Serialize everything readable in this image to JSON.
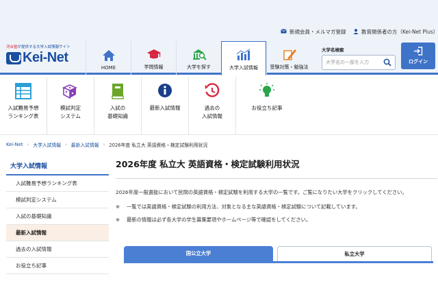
{
  "utility": {
    "signup": "新規会員・メルマガ登録",
    "educators": "教育関係者の方（Kei-Net Plus）"
  },
  "logo": {
    "tagline_prefix": "河合塾",
    "tagline_rest": "が提供する大学入試情報サイト",
    "name": "Kei-Net"
  },
  "nav": [
    {
      "label": "HOME",
      "icon": "home-icon",
      "color": "#3f73c8"
    },
    {
      "label": "学問情報",
      "icon": "graduation-cap-icon",
      "color": "#d9263f"
    },
    {
      "label": "大学を探す",
      "icon": "building-search-icon",
      "color": "#2aa64a"
    },
    {
      "label": "大学入試情報",
      "icon": "bar-chart-icon",
      "color": "#3f73c8"
    },
    {
      "label": "受験対策・勉強法",
      "icon": "pencil-note-icon",
      "color": "#e87d1e"
    }
  ],
  "search": {
    "title": "大学名検索",
    "placeholder": "大学名の一部を入力"
  },
  "login": {
    "label": "ログイン"
  },
  "categories": [
    {
      "line1": "入試難易予想",
      "line2": "ランキング表",
      "icon": "table-icon",
      "color": "#2a9fd6"
    },
    {
      "line1": "模試判定",
      "line2": "システム",
      "icon": "dice-icon",
      "color": "#8a3fb8"
    },
    {
      "line1": "入試の",
      "line2": "基礎知識",
      "icon": "book-icon",
      "color": "#6aa52a"
    },
    {
      "line1": "最新入試情報",
      "line2": "",
      "icon": "info-icon",
      "color": "#1a3f8a"
    },
    {
      "line1": "過去の",
      "line2": "入試情報",
      "icon": "history-icon",
      "color": "#d9263f"
    },
    {
      "line1": "お役立ち記事",
      "line2": "",
      "icon": "lightbulb-icon",
      "color": "#2aa64a"
    }
  ],
  "breadcrumb": [
    "Kei-Net",
    "大学入試情報",
    "最新入試情報",
    "2026年度 私立大 英語資格・検定試験利用状況"
  ],
  "sidebar": {
    "heading": "大学入試情報",
    "items": [
      {
        "label": "入試難易予想ランキング表",
        "active": false
      },
      {
        "label": "模試判定システム",
        "active": false
      },
      {
        "label": "入試の基礎知識",
        "active": false
      },
      {
        "label": "最新入試情報",
        "active": true
      },
      {
        "label": "過去の入試情報",
        "active": false
      },
      {
        "label": "お役立ち記事",
        "active": false
      }
    ]
  },
  "main": {
    "title": "2026年度 私立大 英語資格・検定試験利用状況",
    "intro": "2026年度一般選抜において民間の英語資格・検定試験を利用する大学の一覧です。ご覧になりたい大学をクリックしてください。",
    "notes": [
      {
        "mark": "※",
        "text": "一覧では英語資格・検定試験の利用方法、対象となる主な英語資格・検定試験について記載しています。"
      },
      {
        "mark": "※",
        "text": "最新の情報は必ず各大学の学生募集要項やホームページ等で確認をしてください。"
      }
    ]
  },
  "tabs": [
    {
      "label": "国公立大学",
      "active": false
    },
    {
      "label": "私立大学",
      "active": true
    }
  ]
}
